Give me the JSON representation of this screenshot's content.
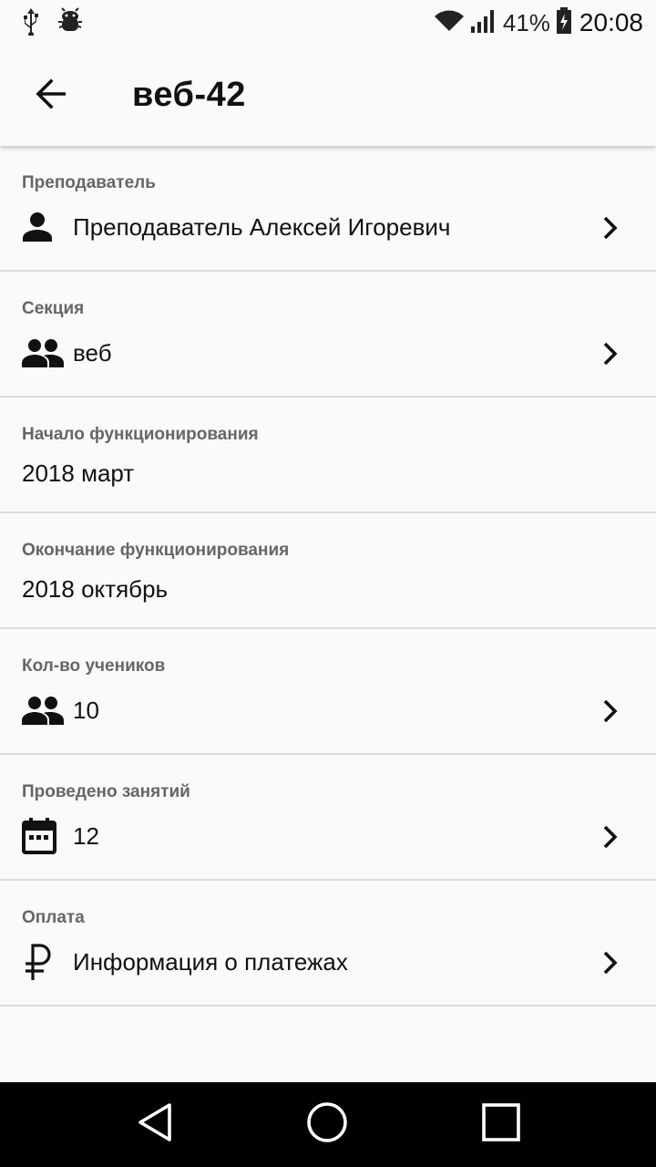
{
  "status_bar": {
    "battery_percent": "41%",
    "time": "20:08",
    "left_icons": [
      "usb-icon",
      "android-debug-icon"
    ],
    "right_icons": [
      "wifi-icon",
      "signal-icon",
      "battery-charging-icon"
    ]
  },
  "app_bar": {
    "title": "веб-42",
    "back_icon": "arrow-back-icon"
  },
  "rows": [
    {
      "caption": "Преподаватель",
      "value": "Преподаватель Алексей Игоревич",
      "icon": "person-icon",
      "navigable": true
    },
    {
      "caption": "Секция",
      "value": "веб",
      "icon": "group-icon",
      "navigable": true
    },
    {
      "caption": "Начало функционирования",
      "value": "2018 март",
      "icon": "",
      "navigable": false
    },
    {
      "caption": "Окончание функционирования",
      "value": "2018 октябрь",
      "icon": "",
      "navigable": false
    },
    {
      "caption": "Кол-во учеников",
      "value": "10",
      "icon": "group-icon",
      "navigable": true
    },
    {
      "caption": "Проведено занятий",
      "value": "12",
      "icon": "calendar-icon",
      "navigable": true
    },
    {
      "caption": "Оплата",
      "value": "Информация о платежах",
      "icon": "ruble-icon",
      "navigable": true
    }
  ],
  "nav_bar": {
    "buttons": [
      "back-triangle-icon",
      "home-circle-icon",
      "recents-square-icon"
    ]
  },
  "colors": {
    "background": "#fafafa",
    "caption": "#666666",
    "divider": "#dcdcdc",
    "nav_bar": "#000000"
  }
}
